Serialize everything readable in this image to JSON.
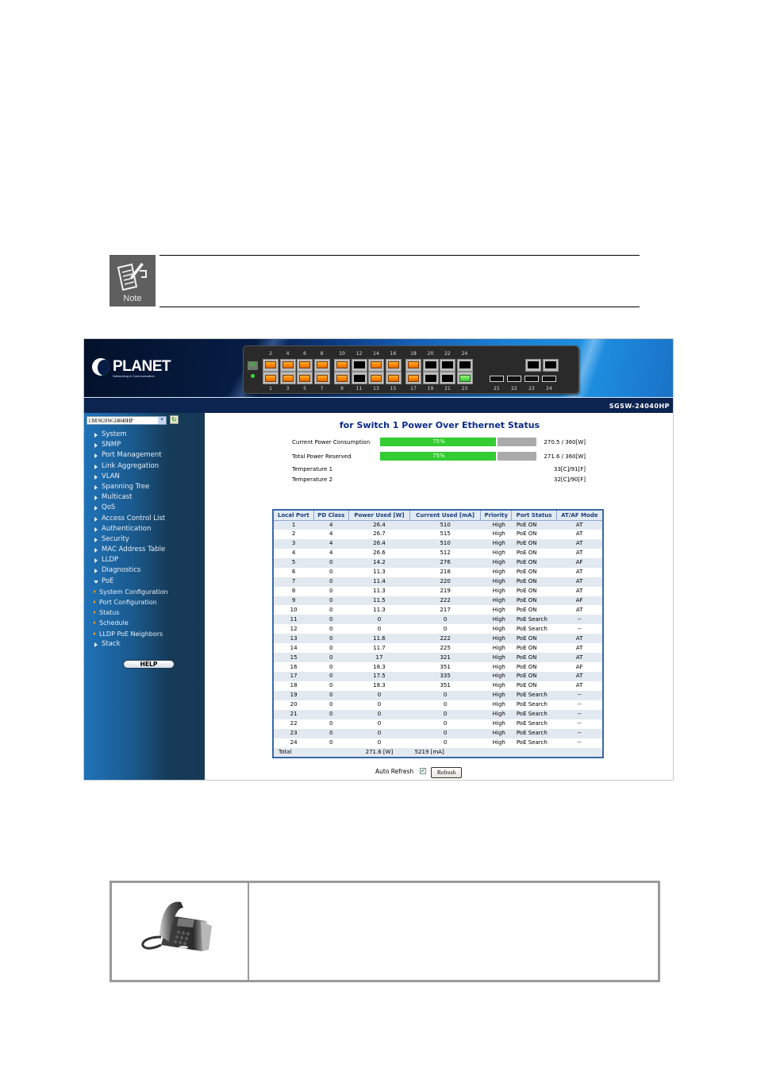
{
  "note": {
    "label": "Note"
  },
  "device": {
    "brand": "PLANET",
    "brand_tagline": "Networking & Communication",
    "model": "SGSW-24040HP",
    "unit_id": "01",
    "ports_top": [
      "2",
      "4",
      "6",
      "8",
      "10",
      "12",
      "14",
      "16",
      "18",
      "20",
      "22",
      "24"
    ],
    "ports_bottom": [
      "1",
      "3",
      "5",
      "7",
      "9",
      "11",
      "13",
      "15",
      "17",
      "19",
      "21",
      "23"
    ],
    "sfp_ports": [
      "21",
      "22",
      "23",
      "24"
    ]
  },
  "sidebar": {
    "switch_select": "1:M:SGSW-24040HP",
    "items": [
      {
        "label": "System"
      },
      {
        "label": "SNMP"
      },
      {
        "label": "Port Management"
      },
      {
        "label": "Link Aggregation"
      },
      {
        "label": "VLAN"
      },
      {
        "label": "Spanning Tree"
      },
      {
        "label": "Multicast"
      },
      {
        "label": "QoS"
      },
      {
        "label": "Access Control List"
      },
      {
        "label": "Authentication"
      },
      {
        "label": "Security"
      },
      {
        "label": "MAC Address Table"
      },
      {
        "label": "LLDP"
      },
      {
        "label": "Diagnostics"
      },
      {
        "label": "PoE"
      },
      {
        "label": "System Configuration"
      },
      {
        "label": "Port Configuration"
      },
      {
        "label": "Status"
      },
      {
        "label": "Schedule"
      },
      {
        "label": "LLDP PoE Neighbors"
      },
      {
        "label": "Stack"
      }
    ],
    "help_label": "HELP"
  },
  "main": {
    "title": "for Switch 1 Power Over Ethernet Status",
    "stats": {
      "consumption_label": "Current Power Consumption",
      "consumption_pct": "75%",
      "consumption_fraction": 0.75,
      "consumption_value": "270.5 / 360[W]",
      "reserved_label": "Total Power Reserved",
      "reserved_pct": "75%",
      "reserved_fraction": 0.75,
      "reserved_value": "271.6 / 360[W]",
      "temp1_label": "Temperature 1",
      "temp1_value": "33[C]/91[F]",
      "temp2_label": "Temperature 2",
      "temp2_value": "32[C]/90[F]"
    },
    "table": {
      "headers": [
        "Local Port",
        "PD Class",
        "Power Used [W]",
        "Current Used [mA]",
        "Priority",
        "Port Status",
        "AT/AF Mode"
      ],
      "rows": [
        [
          "1",
          "4",
          "26.4",
          "510",
          "High",
          "PoE ON",
          "AT"
        ],
        [
          "2",
          "4",
          "26.7",
          "515",
          "High",
          "PoE ON",
          "AT"
        ],
        [
          "3",
          "4",
          "26.4",
          "510",
          "High",
          "PoE ON",
          "AT"
        ],
        [
          "4",
          "4",
          "26.6",
          "512",
          "High",
          "PoE ON",
          "AT"
        ],
        [
          "5",
          "0",
          "14.2",
          "276",
          "High",
          "PoE ON",
          "AF"
        ],
        [
          "6",
          "0",
          "11.3",
          "218",
          "High",
          "PoE ON",
          "AT"
        ],
        [
          "7",
          "0",
          "11.4",
          "220",
          "High",
          "PoE ON",
          "AT"
        ],
        [
          "8",
          "0",
          "11.3",
          "219",
          "High",
          "PoE ON",
          "AT"
        ],
        [
          "9",
          "0",
          "11.5",
          "222",
          "High",
          "PoE ON",
          "AF"
        ],
        [
          "10",
          "0",
          "11.3",
          "217",
          "High",
          "PoE ON",
          "AT"
        ],
        [
          "11",
          "0",
          "0",
          "0",
          "High",
          "PoE Search",
          "--"
        ],
        [
          "12",
          "0",
          "0",
          "0",
          "High",
          "PoE Search",
          "--"
        ],
        [
          "13",
          "0",
          "11.6",
          "222",
          "High",
          "PoE ON",
          "AT"
        ],
        [
          "14",
          "0",
          "11.7",
          "225",
          "High",
          "PoE ON",
          "AT"
        ],
        [
          "15",
          "0",
          "17",
          "321",
          "High",
          "PoE ON",
          "AT"
        ],
        [
          "16",
          "0",
          "18.3",
          "351",
          "High",
          "PoE ON",
          "AF"
        ],
        [
          "17",
          "0",
          "17.5",
          "335",
          "High",
          "PoE ON",
          "AT"
        ],
        [
          "18",
          "0",
          "18.3",
          "351",
          "High",
          "PoE ON",
          "AT"
        ],
        [
          "19",
          "0",
          "0",
          "0",
          "High",
          "PoE Search",
          "--"
        ],
        [
          "20",
          "0",
          "0",
          "0",
          "High",
          "PoE Search",
          "--"
        ],
        [
          "21",
          "0",
          "0",
          "0",
          "High",
          "PoE Search",
          "--"
        ],
        [
          "22",
          "0",
          "0",
          "0",
          "High",
          "PoE Search",
          "--"
        ],
        [
          "23",
          "0",
          "0",
          "0",
          "High",
          "PoE Search",
          "--"
        ],
        [
          "24",
          "0",
          "0",
          "0",
          "High",
          "PoE Search",
          "--"
        ]
      ],
      "total_label": "Total",
      "total_power": "271.6 [W]",
      "total_current": "5219 [mA]"
    },
    "auto_refresh_label": "Auto Refresh",
    "auto_refresh_checked": true,
    "refresh_button": "Refresh"
  },
  "colors": {
    "progress_fill": "#33cc33",
    "progress_track": "#aaaaaa",
    "title_blue": "#0a2a8a",
    "port_active": "#ff8000",
    "port_link_green": "#3cc83c"
  }
}
